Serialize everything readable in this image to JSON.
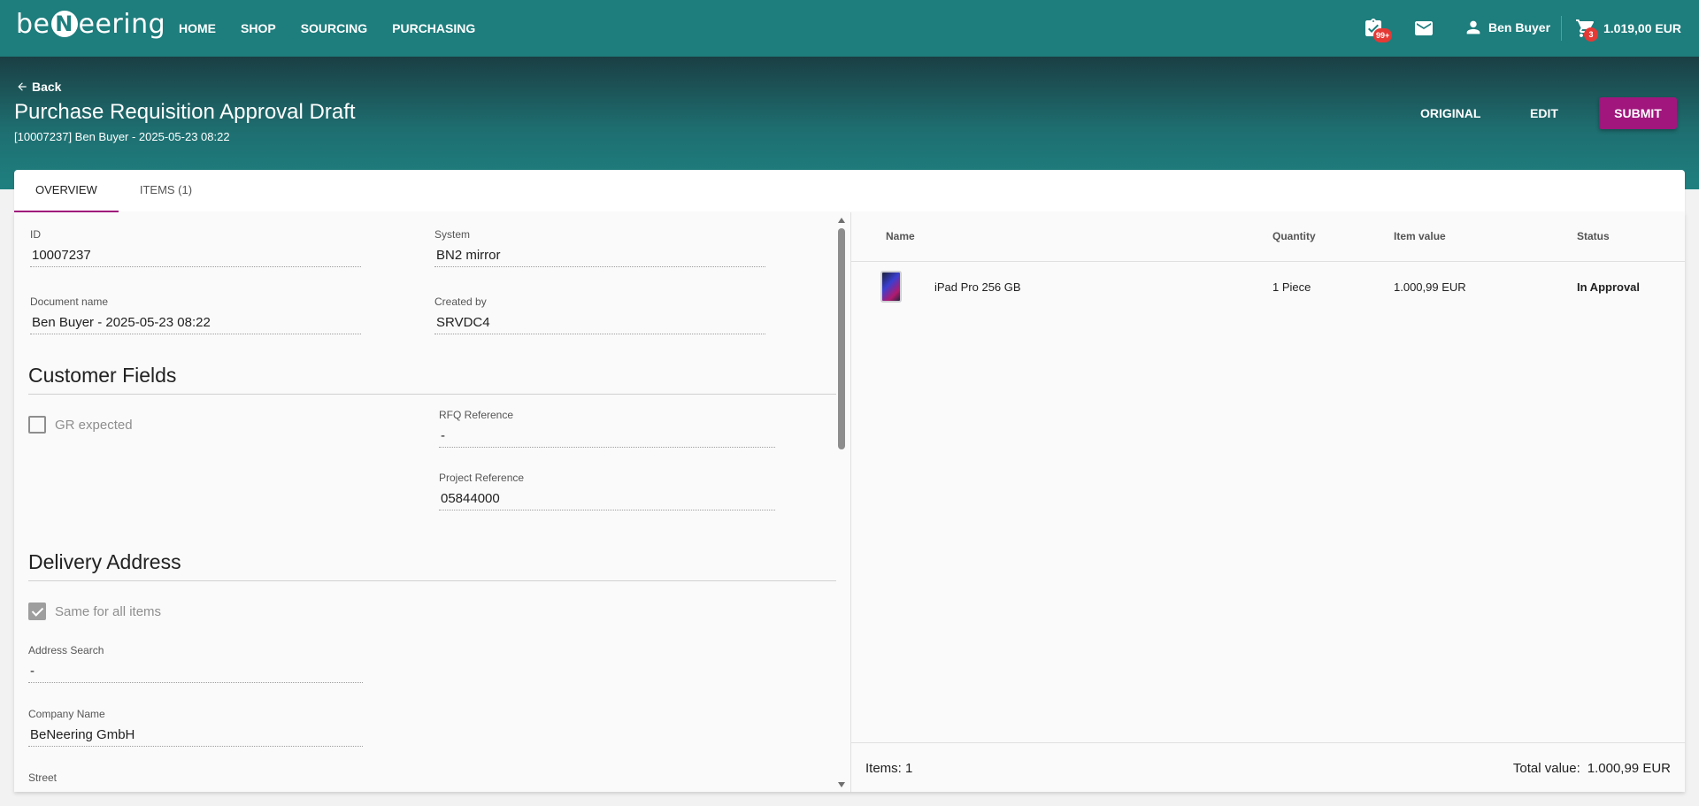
{
  "topbar": {
    "logo": {
      "pre": "be",
      "mark": "N",
      "post": "eering"
    },
    "nav": [
      "HOME",
      "SHOP",
      "SOURCING",
      "PURCHASING"
    ],
    "approvals_badge": "99+",
    "user_name": "Ben Buyer",
    "cart_badge": "3",
    "cart_total": "1.019,00 EUR",
    "icons": [
      "clipboard-check-icon",
      "mail-icon",
      "person-icon",
      "cart-icon"
    ]
  },
  "header": {
    "back_label": "Back",
    "title": "Purchase Requisition Approval Draft",
    "subtitle": "[10007237] Ben Buyer - 2025-05-23 08:22",
    "actions": {
      "original": "ORIGINAL",
      "edit": "EDIT",
      "submit": "SUBMIT"
    },
    "submit_color": "#a1167d"
  },
  "tabs": [
    {
      "label": "OVERVIEW",
      "active": true
    },
    {
      "label": "ITEMS (1)",
      "active": false
    }
  ],
  "overview": {
    "id": {
      "label": "ID",
      "value": "10007237"
    },
    "system": {
      "label": "System",
      "value": "BN2 mirror"
    },
    "document_name": {
      "label": "Document name",
      "value": "Ben Buyer - 2025-05-23 08:22"
    },
    "created_by": {
      "label": "Created by",
      "value": "SRVDC4"
    },
    "customer_fields": {
      "title": "Customer Fields",
      "gr_expected": {
        "label": "GR expected",
        "checked": false
      },
      "rfq_reference": {
        "label": "RFQ Reference",
        "value": "-"
      },
      "project_reference": {
        "label": "Project Reference",
        "value": "05844000"
      }
    },
    "delivery_address": {
      "title": "Delivery Address",
      "same_for_all": {
        "label": "Same for all items",
        "checked": true
      },
      "address_search": {
        "label": "Address Search",
        "value": "-"
      },
      "company_name": {
        "label": "Company Name",
        "value": "BeNeering GmbH"
      },
      "street": {
        "label": "Street"
      }
    }
  },
  "items_table": {
    "columns": [
      "Name",
      "Quantity",
      "Item value",
      "Status"
    ],
    "rows": [
      {
        "name": "iPad Pro 256 GB",
        "quantity": "1 Piece",
        "item_value": "1.000,99 EUR",
        "status": "In Approval"
      }
    ],
    "footer": {
      "items": "Items: 1",
      "total_label": "Total value:",
      "total_value": "1.000,99 EUR"
    }
  }
}
